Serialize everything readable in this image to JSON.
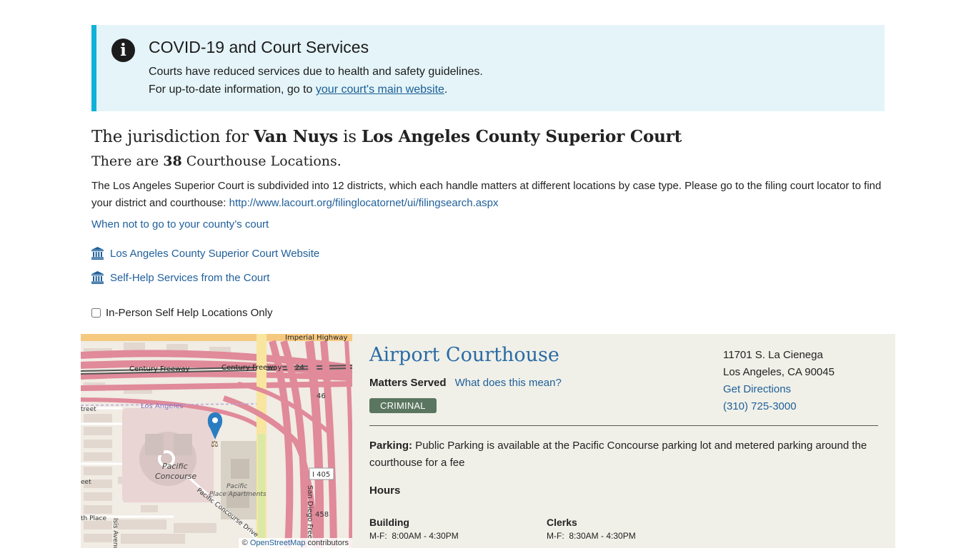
{
  "alert": {
    "title": "COVID-19 and Court Services",
    "line1": "Courts have reduced services due to health and safety guidelines.",
    "line2_prefix": "For up-to-date information, go to ",
    "line2_link": "your court's main website",
    "line2_suffix": ".",
    "icon": "info-icon"
  },
  "jurisdiction": {
    "prefix": "The jurisdiction for ",
    "city": "Van Nuys",
    "middle": " is ",
    "court": "Los Angeles County Superior Court"
  },
  "count": {
    "prefix": "There are ",
    "number": "38",
    "suffix": " Courthouse Locations."
  },
  "description": {
    "text": "The Los Angeles Superior Court is subdivided into 12 districts, which each handle matters at different locations by case type. Please go to the filing court locator to find your district and courthouse: ",
    "link": "http://www.lacourt.org/filinglocatornet/ui/filingsearch.aspx"
  },
  "links": {
    "when_not": "When not to go to your county’s court",
    "website": "Los Angeles County Superior Court Website",
    "self_help": "Self-Help Services from the Court"
  },
  "filter": {
    "label": "In-Person Self Help Locations Only",
    "checked": false
  },
  "map": {
    "labels": {
      "imperial": "Imperial Highway",
      "century1": "Century Freeway",
      "century2": "Century Freeway",
      "los_angeles": "Los Angeles",
      "street": "treet",
      "pacific": "Pacific",
      "concourse": "Concourse",
      "pacific2": "Pacific",
      "place_apts": "Place Apartments",
      "pacific_drive": "Pacific Concourse Drive",
      "i405": "I 405",
      "san_diego": "San Diego Freew",
      "r24": "24",
      "r46": "46",
      "r458": "458",
      "place": "th Place",
      "avenue": "Isis Avenu",
      "eet": "eet"
    },
    "attribution_prefix": "© ",
    "attribution_link": "OpenStreetMap",
    "attribution_suffix": " contributors",
    "marker_icon": "map-pin-icon"
  },
  "courthouse": {
    "name": "Airport Courthouse",
    "matters_label": "Matters Served",
    "matters_link": "What does this mean?",
    "badge": "CRIMINAL",
    "address1": "11701 S. La Cienega",
    "address2": "Los Angeles, CA 90045",
    "directions": "Get Directions",
    "phone": "(310) 725-3000",
    "parking_label": "Parking:",
    "parking_text": " Public Parking is available at the Pacific Concourse parking lot and metered parking around the courthouse for a fee",
    "hours_title": "Hours",
    "building_label": "Building",
    "building_hours": "M-F:  8:00AM - 4:30PM",
    "clerks_label": "Clerks",
    "clerks_hours": "M-F:  8:30AM - 4:30PM"
  }
}
